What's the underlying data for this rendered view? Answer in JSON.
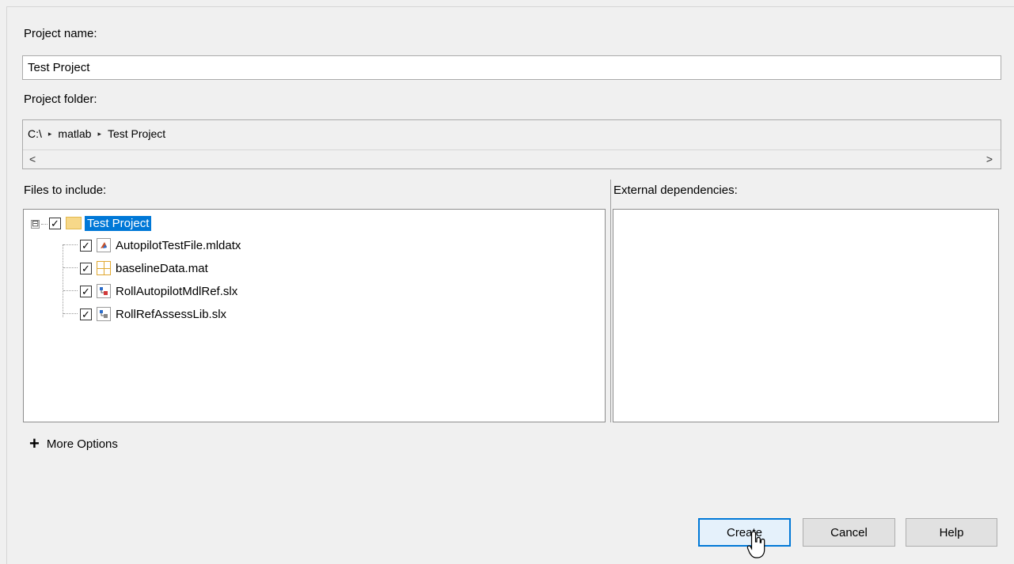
{
  "labels": {
    "project_name": "Project name:",
    "project_folder": "Project folder:",
    "files_to_include": "Files to include:",
    "external_dependencies": "External dependencies:"
  },
  "project_name_input": {
    "value": "Test Project"
  },
  "folder_path": {
    "segments": [
      "C:\\",
      "matlab",
      "Test Project"
    ],
    "separator": "▸",
    "scroll_left": "<",
    "scroll_right": ">"
  },
  "files_tree": {
    "root": {
      "label": "Test Project",
      "checked": true,
      "expanded": true,
      "selected": true,
      "icon": "folder-icon",
      "expander_symbol": "⊟"
    },
    "children": [
      {
        "label": "AutopilotTestFile.mldatx",
        "checked": true,
        "icon": "test-file-icon"
      },
      {
        "label": "baselineData.mat",
        "checked": true,
        "icon": "mat-file-icon"
      },
      {
        "label": "RollAutopilotMdlRef.slx",
        "checked": true,
        "icon": "simulink-model-icon"
      },
      {
        "label": "RollRefAssessLib.slx",
        "checked": true,
        "icon": "simulink-library-icon"
      }
    ]
  },
  "more_options": {
    "label": "More Options",
    "icon": "plus-icon"
  },
  "buttons": {
    "create": "Create",
    "cancel": "Cancel",
    "help": "Help"
  },
  "colors": {
    "selection": "#0078d7",
    "background": "#f0f0f0",
    "primary_button_border": "#0078d7"
  }
}
